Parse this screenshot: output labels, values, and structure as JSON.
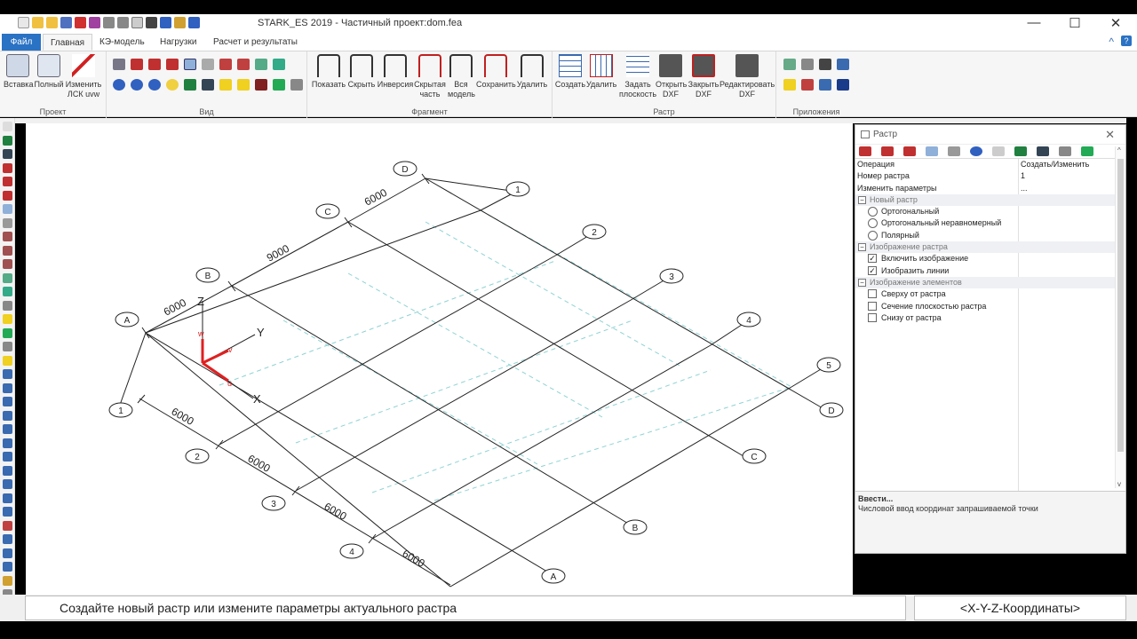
{
  "app": {
    "title": "STARK_ES 2019 - Частичный проект:dom.fea"
  },
  "window_controls": {
    "minimize": "—",
    "maximize": "☐",
    "close": "✕"
  },
  "tabs": [
    "Файл",
    "Главная",
    "КЭ-модель",
    "Нагрузки",
    "Расчет и результаты"
  ],
  "groups": {
    "project": {
      "label": "Проект",
      "buttons": [
        "Вставка",
        "Полный",
        "Изменить ЛСК uvw"
      ]
    },
    "view": {
      "label": "Вид"
    },
    "fragment": {
      "label": "Фрагмент",
      "buttons": [
        "Показать",
        "Скрыть",
        "Инверсия",
        "Скрытая часть",
        "Вся модель",
        "Сохранить",
        "Удалить"
      ]
    },
    "raster": {
      "label": "Растр",
      "buttons": [
        "Создать",
        "Удалить",
        "Задать плоскость",
        "Открыть DXF",
        "Закрыть DXF",
        "Редактировать DXF"
      ]
    },
    "apps": {
      "label": "Приложения"
    }
  },
  "canvas": {
    "letters_left": [
      "A",
      "B",
      "C",
      "D"
    ],
    "letters_right": [
      "A",
      "B",
      "C",
      "D"
    ],
    "numbers_top": [
      "1",
      "2",
      "3",
      "4",
      "5"
    ],
    "numbers_bottom": [
      "1",
      "2",
      "3",
      "4"
    ],
    "dims_left": [
      "6000",
      "9000",
      "6000"
    ],
    "dims_bottom": [
      "6000",
      "6000",
      "6000",
      "6000"
    ],
    "axis_labels": {
      "x": "X",
      "y": "Y",
      "z": "Z",
      "u": "u",
      "v": "v",
      "w": "w"
    }
  },
  "panel": {
    "title": "Растр",
    "rows": [
      {
        "key": "Операция",
        "value": "Создать/Изменить"
      },
      {
        "key": "Номер растра",
        "value": "1"
      },
      {
        "key": "Изменить параметры",
        "value": "..."
      }
    ],
    "section_new": "Новый растр",
    "radios": [
      "Ортогональный",
      "Ортогональный неравномерный",
      "Полярный"
    ],
    "section_image": "Изображение растра",
    "image_checks": [
      {
        "label": "Включить изображение",
        "checked": true
      },
      {
        "label": "Изобразить линии",
        "checked": true
      }
    ],
    "section_elements": "Изображение элементов",
    "element_checks": [
      {
        "label": "Сверху от растра",
        "checked": false
      },
      {
        "label": "Сечение плоскостью растра",
        "checked": false
      },
      {
        "label": "Снизу от растра",
        "checked": false
      }
    ],
    "help_title": "Ввести...",
    "help_text": "Числовой ввод координат запрашиваемой точки"
  },
  "status": {
    "message": "Создайте новый растр или измените параметры актуального растра",
    "coords": "<X-Y-Z-Координаты>"
  },
  "colors": {
    "accent": "#2a72c4",
    "grid_line": "#8fd3d3",
    "axis_red": "#e02020"
  }
}
